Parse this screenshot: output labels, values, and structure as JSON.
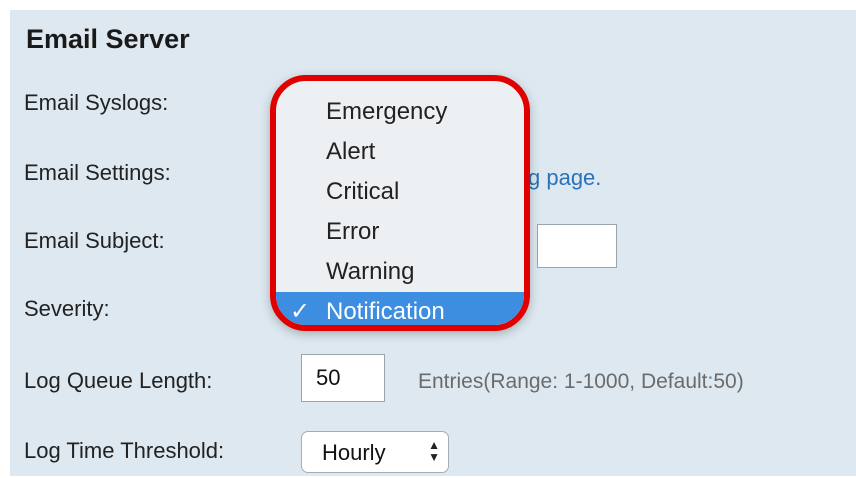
{
  "section_title": "Email Server",
  "labels": {
    "email_syslogs": "Email Syslogs:",
    "email_settings": "Email Settings:",
    "email_subject": "Email Subject:",
    "severity": "Severity:",
    "log_queue_length": "Log Queue Length:",
    "log_time_threshold": "Log Time Threshold:"
  },
  "email_settings_link_partial": "g page.",
  "log_queue_length_value": "50",
  "log_queue_hint": "Entries(Range: 1-1000, Default:50)",
  "log_time_threshold_value": "Hourly",
  "severity_dropdown": {
    "items": [
      "Emergency",
      "Alert",
      "Critical",
      "Error",
      "Warning",
      "Notification"
    ],
    "selected": "Notification",
    "check_glyph": "✓"
  },
  "colors": {
    "panel_bg": "#dde8f0",
    "highlight_ring": "#e00000",
    "selected_bg": "#3d8ee0",
    "link": "#2a73b8"
  }
}
